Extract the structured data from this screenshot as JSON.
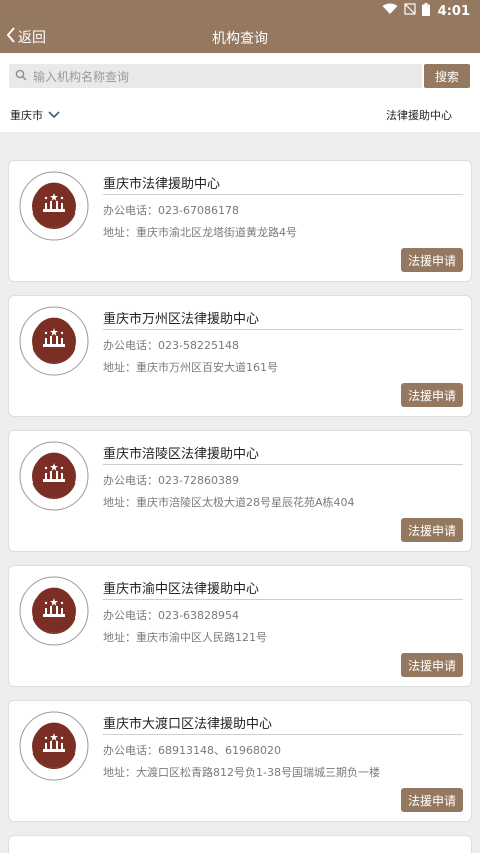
{
  "status_bar": {
    "time": "4:01"
  },
  "header": {
    "back_label": "返回",
    "title": "机构查询"
  },
  "search": {
    "placeholder": "输入机构名称查询",
    "button_label": "搜索"
  },
  "filter": {
    "city": "重庆市",
    "category": "法律援助中心"
  },
  "apply_label": "法援申请",
  "phone_prefix": "办公电话：",
  "addr_prefix": "地址：",
  "colors": {
    "brand": "#94785f",
    "background": "#eeeeee",
    "logo": "#7a2e24"
  },
  "organizations": [
    {
      "name": "重庆市法律援助中心",
      "phone": "023-67086178",
      "address": "重庆市渝北区龙塔街道黄龙路4号"
    },
    {
      "name": "重庆市万州区法律援助中心",
      "phone": "023-58225148",
      "address": "重庆市万州区百安大道161号"
    },
    {
      "name": "重庆市涪陵区法律援助中心",
      "phone": "023-72860389",
      "address": "重庆市涪陵区太极大道28号星辰花苑A栋404"
    },
    {
      "name": "重庆市渝中区法律援助中心",
      "phone": "023-63828954",
      "address": "重庆市渝中区人民路121号"
    },
    {
      "name": "重庆市大渡口区法律援助中心",
      "phone": "68913148、61968020",
      "address": "大渡口区松青路812号负1-38号国瑞城三期负一楼"
    }
  ]
}
